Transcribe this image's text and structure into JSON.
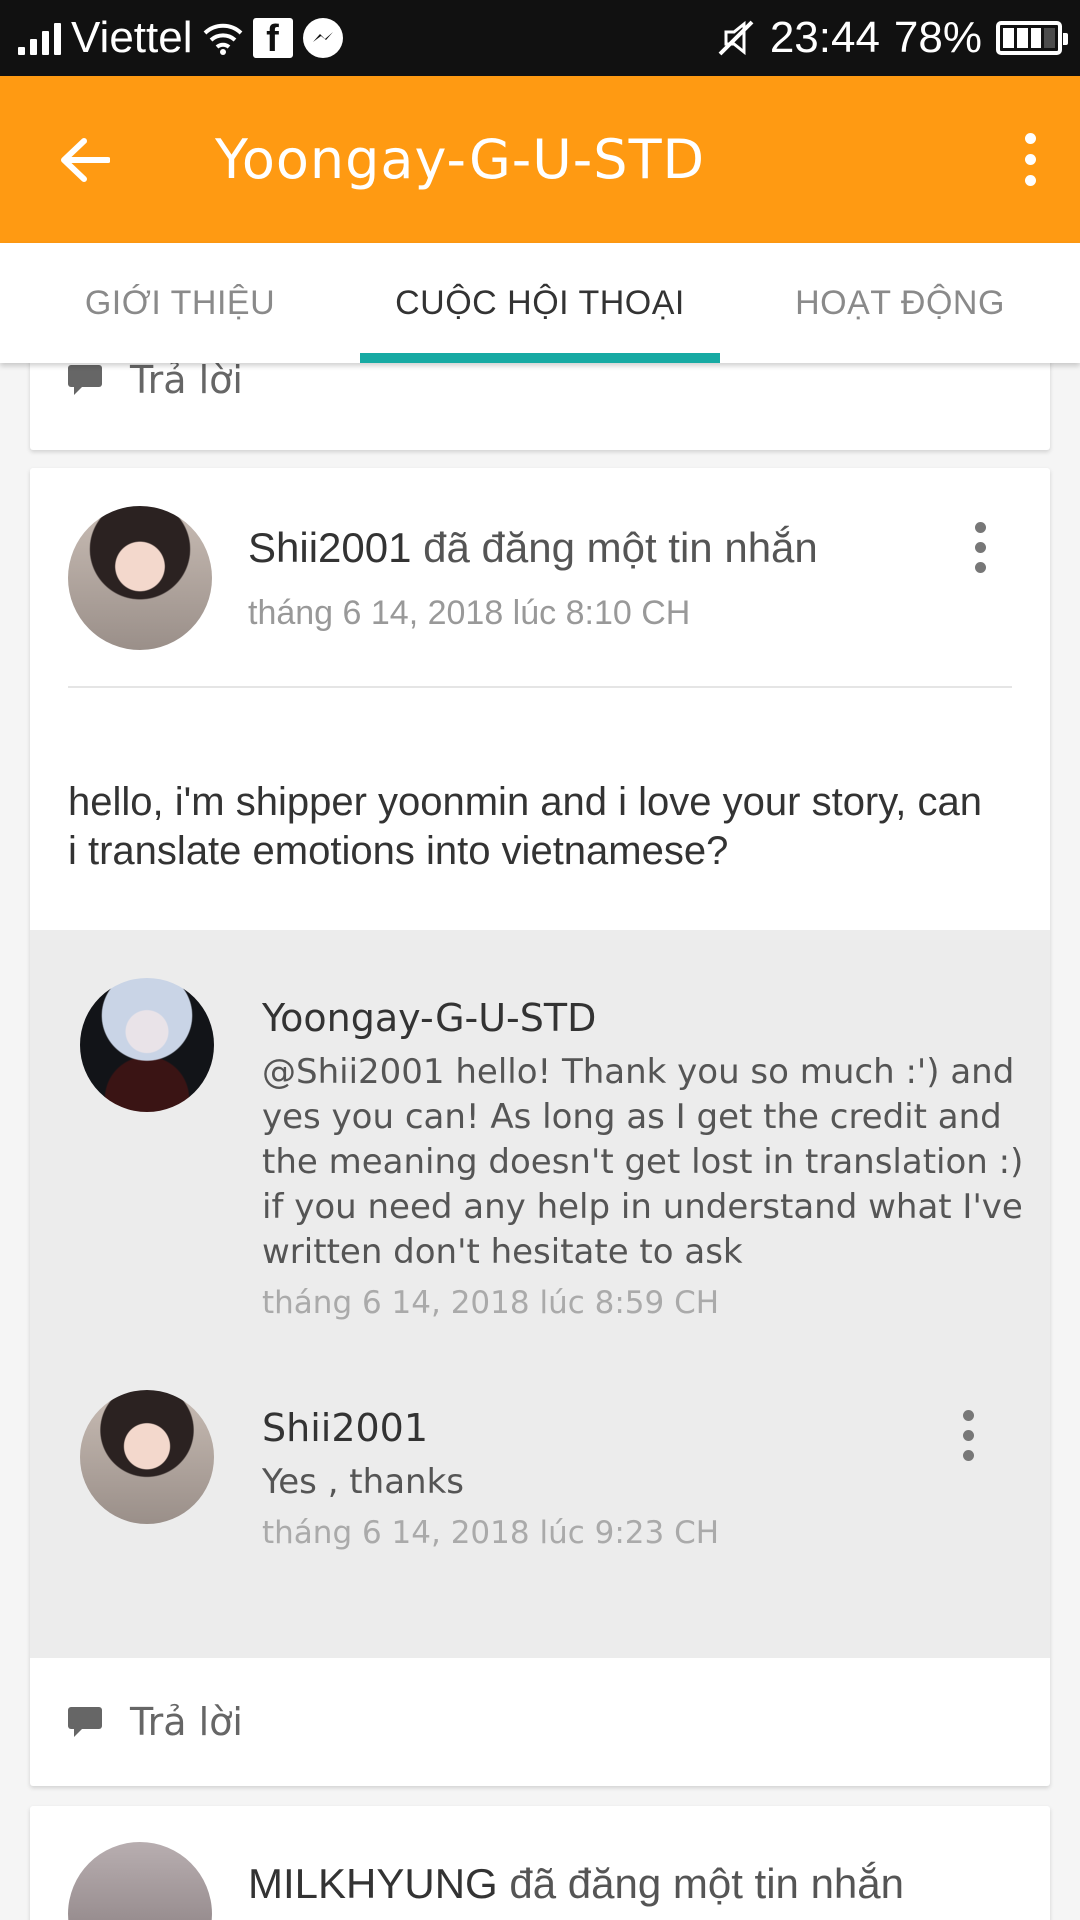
{
  "status_bar": {
    "carrier": "Viettel",
    "time": "23:44",
    "battery": "78%"
  },
  "app_bar": {
    "title": "Yoongay-G-U-STD"
  },
  "tabs": [
    {
      "label": "GIỚI THIỆU",
      "active": false
    },
    {
      "label": "CUỘC HỘI THOẠI",
      "active": true
    },
    {
      "label": "HOẠT ĐỘNG",
      "active": false
    }
  ],
  "prev_card": {
    "reply_label": "Trả lời"
  },
  "post": {
    "author": "Shii2001",
    "action": "đã đăng một tin nhắn",
    "time": "tháng 6 14, 2018 lúc 8:10 CH",
    "body": "hello, i'm shipper yoonmin and i love your story, can i translate emotions into vietnamese?",
    "replies": [
      {
        "author": "Yoongay-G-U-STD",
        "text": "@Shii2001 hello! Thank you so much :') and yes you can! As long as I get the credit and the meaning doesn't get lost in translation :) if you need any help in understand what I've written don't hesitate to ask",
        "time": "tháng 6 14, 2018 lúc 8:59 CH"
      },
      {
        "author": "Shii2001",
        "text": "Yes , thanks",
        "time": "tháng 6 14, 2018 lúc 9:23 CH"
      }
    ],
    "reply_label": "Trả lời"
  },
  "next_post": {
    "author": "MILKHYUNG",
    "action": "đã đăng một tin nhắn"
  },
  "colors": {
    "app_bar": "#ff9a12",
    "tab_indicator": "#17aaa3",
    "status_bar": "#111111",
    "reply_bg": "#ececec"
  }
}
